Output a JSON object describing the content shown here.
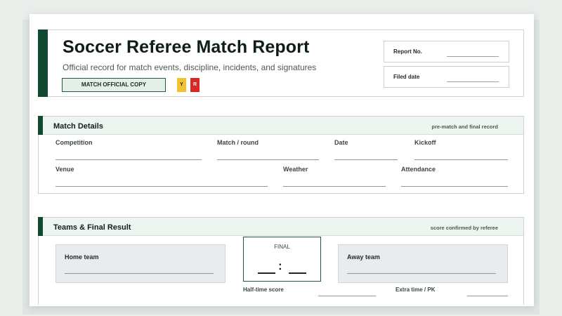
{
  "header": {
    "title": "Soccer Referee Match Report",
    "subtitle": "Official record for match events, discipline, incidents, and signatures",
    "badge": "MATCH OFFICIAL COPY",
    "yellow_card": "Y",
    "red_card": "R",
    "report_no_label": "Report No.",
    "filed_date_label": "Filed date"
  },
  "match_details": {
    "title": "Match Details",
    "note": "pre-match and final record",
    "fields": {
      "competition": "Competition",
      "match_round": "Match / round",
      "date": "Date",
      "kickoff": "Kickoff",
      "venue": "Venue",
      "weather": "Weather",
      "attendance": "Attendance"
    }
  },
  "teams": {
    "title": "Teams & Final Result",
    "note": "score confirmed by referee",
    "home_label": "Home team",
    "away_label": "Away team",
    "final_label": "FINAL",
    "score_separator": ":",
    "halftime_label": "Half-time score",
    "extratime_label": "Extra time / PK"
  },
  "colors": {
    "brand": "#0f4a30",
    "yellow_card": "#f2c230",
    "red_card": "#d72825"
  }
}
